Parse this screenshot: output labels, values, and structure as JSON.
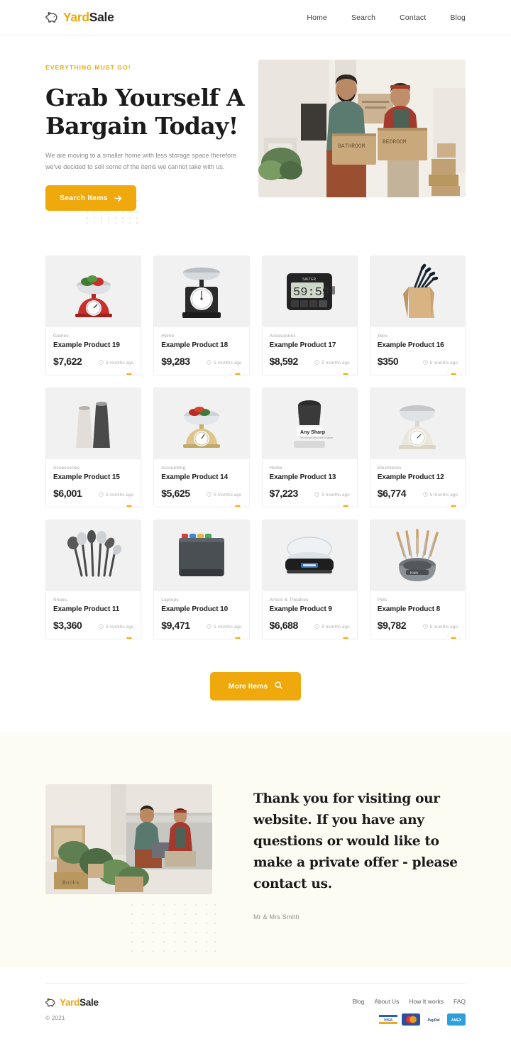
{
  "brand": {
    "name_part1": "Yard",
    "name_part2": "Sale",
    "icon": "piggy-bank-icon"
  },
  "nav": {
    "items": [
      {
        "label": "Home"
      },
      {
        "label": "Search"
      },
      {
        "label": "Contact"
      },
      {
        "label": "Blog"
      }
    ]
  },
  "hero": {
    "eyebrow": "EVERYTHING MUST GO!",
    "title": "Grab Yourself A Bargain Today!",
    "description": "We are moving to a smaller home with less storage space therefore we've decided to sell some of the items we cannot take with us.",
    "cta_label": "Search Items",
    "cta_icon": "arrow-right-icon",
    "image_alt": "Couple holding moving boxes labelled BATHROOM and BEDROOM"
  },
  "products": {
    "time_icon": "clock-icon",
    "fav_icon": "heart-icon",
    "items": [
      {
        "category": "Games",
        "title": "Example Product 19",
        "price": "$7,622",
        "time": "5 months ago",
        "image_alt": "Red kitchen scale with vegetables"
      },
      {
        "category": "Home",
        "title": "Example Product 18",
        "price": "$9,283",
        "time": "5 months ago",
        "image_alt": "Black vintage kitchen scale"
      },
      {
        "category": "Accessories",
        "title": "Example Product 17",
        "price": "$8,592",
        "time": "5 months ago",
        "image_alt": "Salter digital kitchen timer"
      },
      {
        "category": "xbox",
        "title": "Example Product 16",
        "price": "$350",
        "time": "5 months ago",
        "image_alt": "Wooden knife block with knives"
      },
      {
        "category": "Accessories",
        "title": "Example Product 15",
        "price": "$6,001",
        "time": "5 months ago",
        "image_alt": "Salt and pepper grinder set"
      },
      {
        "category": "Accounting",
        "title": "Example Product 14",
        "price": "$5,625",
        "time": "5 months ago",
        "image_alt": "Gold kitchen scale with peppers"
      },
      {
        "category": "Home",
        "title": "Example Product 13",
        "price": "$7,223",
        "time": "5 months ago",
        "image_alt": "AnySharp knife sharpener"
      },
      {
        "category": "Electronics",
        "title": "Example Product 12",
        "price": "$6,774",
        "time": "5 months ago",
        "image_alt": "Cream mechanical kitchen scale"
      },
      {
        "category": "Shoes",
        "title": "Example Product 11",
        "price": "$3,360",
        "time": "5 months ago",
        "image_alt": "Kitchen utensil set"
      },
      {
        "category": "Laptops",
        "title": "Example Product 10",
        "price": "$9,471",
        "time": "5 months ago",
        "image_alt": "Colour coded chopping board set"
      },
      {
        "category": "Artists & Theatres",
        "title": "Example Product 9",
        "price": "$6,688",
        "time": "5 months ago",
        "image_alt": "Digital kitchen scale with bowl"
      },
      {
        "category": "Pets",
        "title": "Example Product 8",
        "price": "$9,782",
        "time": "5 months ago",
        "image_alt": "Knife set in stainless steel block"
      }
    ],
    "more_label": "More Items",
    "more_icon": "search-icon"
  },
  "thanks": {
    "title": "Thank you for visiting our website. If you have any questions or would like to make a private offer - please contact us.",
    "signature": "Mr & Mrs Smith",
    "image_alt": "Couple sitting on a sofa with a laptop surrounded by boxes and plants"
  },
  "footer": {
    "copyright": "© 2021",
    "links": [
      {
        "label": "Blog"
      },
      {
        "label": "About Us"
      },
      {
        "label": "How It works"
      },
      {
        "label": "FAQ"
      }
    ],
    "payments": [
      {
        "name": "visa-card-icon",
        "label": "VISA"
      },
      {
        "name": "mastercard-card-icon",
        "label": ""
      },
      {
        "name": "paypal-card-icon",
        "label": "PayPal"
      },
      {
        "name": "amex-card-icon",
        "label": "AMEX"
      }
    ]
  },
  "colors": {
    "accent": "#EFA90C",
    "text_dark": "#1b1b1b",
    "text_muted": "#8a8a8a",
    "cream_bg": "#FDFCF2",
    "card_media_bg": "#f1f1f1"
  }
}
